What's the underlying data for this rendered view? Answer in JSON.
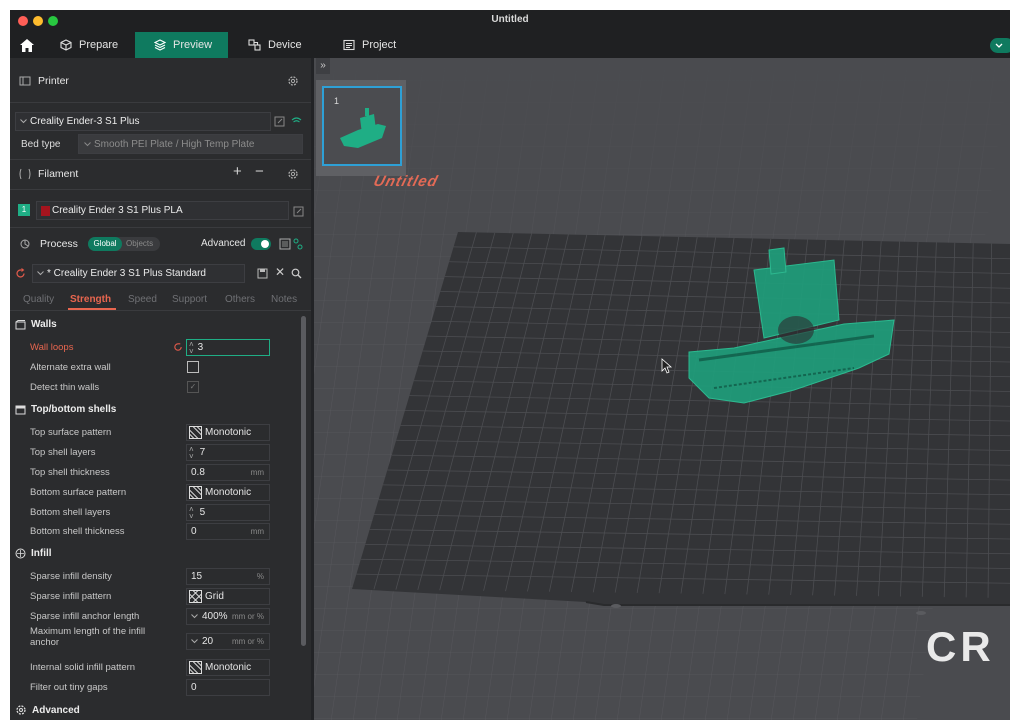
{
  "window": {
    "title": "Untitled"
  },
  "tabs": [
    {
      "label": "Prepare"
    },
    {
      "label": "Preview"
    },
    {
      "label": "Device"
    },
    {
      "label": "Project"
    }
  ],
  "printer": {
    "section_label": "Printer",
    "selected": "Creality Ender-3 S1 Plus",
    "bed_type_label": "Bed type",
    "bed_type_value": "Smooth PEI Plate / High Temp Plate"
  },
  "filament": {
    "section_label": "Filament",
    "slot_number": "1",
    "slot_color": "#a5141e",
    "selected": "Creality Ender 3 S1 Plus PLA"
  },
  "process": {
    "section_label": "Process",
    "global_label": "Global",
    "objects_label": "Objects",
    "advanced_label": "Advanced",
    "advanced_on": true,
    "selected": "* Creality Ender 3 S1 Plus Standard",
    "tabs": [
      "Quality",
      "Strength",
      "Speed",
      "Support",
      "Others",
      "Notes"
    ],
    "active_tab": "Strength"
  },
  "settings": {
    "walls": {
      "title": "Walls",
      "wall_loops_label": "Wall loops",
      "wall_loops_value": "3",
      "alt_extra_wall_label": "Alternate extra wall",
      "detect_thin_walls_label": "Detect thin walls"
    },
    "shells": {
      "title": "Top/bottom shells",
      "top_surface_pattern_label": "Top surface pattern",
      "top_surface_pattern_value": "Monotonic",
      "top_shell_layers_label": "Top shell layers",
      "top_shell_layers_value": "7",
      "top_shell_thickness_label": "Top shell thickness",
      "top_shell_thickness_value": "0.8",
      "bottom_surface_pattern_label": "Bottom surface pattern",
      "bottom_surface_pattern_value": "Monotonic",
      "bottom_shell_layers_label": "Bottom shell layers",
      "bottom_shell_layers_value": "5",
      "bottom_shell_thickness_label": "Bottom shell thickness",
      "bottom_shell_thickness_value": "0",
      "unit_mm": "mm"
    },
    "infill": {
      "title": "Infill",
      "density_label": "Sparse infill density",
      "density_value": "15",
      "density_unit": "%",
      "pattern_label": "Sparse infill pattern",
      "pattern_value": "Grid",
      "anchor_label": "Sparse infill anchor length",
      "anchor_value": "400%",
      "anchor_unit": "mm or %",
      "max_anchor_label_1": "Maximum length of the infill",
      "max_anchor_label_2": "anchor",
      "max_anchor_value": "20",
      "max_anchor_unit": "mm or %",
      "internal_pattern_label": "Internal solid infill pattern",
      "internal_pattern_value": "Monotonic",
      "filter_gaps_label": "Filter out tiny gaps",
      "filter_gaps_value": "0"
    },
    "advanced": {
      "title": "Advanced"
    }
  },
  "viewport": {
    "plate_number": "1",
    "plate_name": "Untitled",
    "bed_brand": "CR",
    "accent_color": "#1fae85"
  }
}
